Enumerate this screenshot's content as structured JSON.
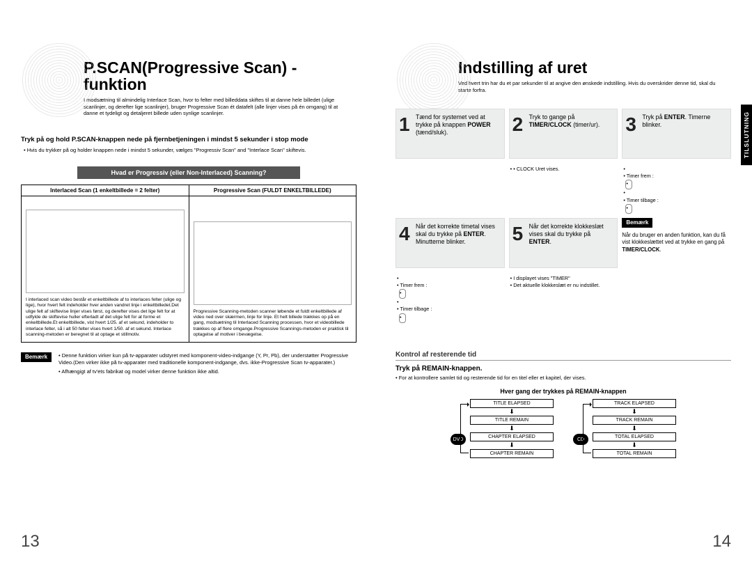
{
  "left": {
    "title": "P.SCAN(Progressive Scan) -funktion",
    "intro": "I modsætning til almindelig Interlace Scan, hvor to felter med billeddata skiftes til at danne hele billedet (ulige scanlinjer, og derefter lige scanlinjer), bruger Progressive Scan ét datafelt (alle linjer vises på én omgang) til at danne et tydeligt og detaljeret billede uden synlige scanlinjer.",
    "instr_title": "Tryk på og hold P.SCAN-knappen nede på fjernbetjeningen i mindst 5 sekunder i stop mode",
    "instr_bullet": "Hvis du trykker på og holder knappen nede i mindst 5 sekunder, vælges \"Progressiv Scan\" and \"Interlace Scan\" skiftevis.",
    "q_heading": "Hvad er Progressiv (eller Non-Interlaced) Scanning?",
    "col_a": "Interlaced Scan (1 enkeltbillede = 2 felter)",
    "col_b": "Progressive Scan (FULDT ENKELTBILLEDE)",
    "desc_a": "I interlaced scan video består et enkeltbillede af to interlaces felter (ulige og lige), hvor hvert felt indeholder hver anden vandret linje i enkeltbilledet.Det ulige felt af skiftevise linjer vises først, og derefter vises det lige felt for at udfylde de skiftevise huller efterladt af det ulige felt for at forme et enkeltbillede.Et enkeltbillede, vist hvert 1/25. af et sekund, indeholder to interlace felter, så i alt 50 felter vises hvert 1/50. af et sekund. Interlace scanning-metoden er beregnet til at optage et stillmotiv.",
    "desc_b": "Progressive Scanning-metoden scanner løbende et fuldt enkeltbillede af video ned over skærmen, linje for linje. Et helt billede trækkes op på en gang, modsætning til Interlaced Scanning processen, hvor et videobillede trækkes op af flere omgange.Progressive Scannings-metoden er praktisk til optagelse af motiver i bevægelse.",
    "note_label": "Bemærk",
    "note1": "Denne funktion virker kun på tv-apparater udstyret med komponent-video-indgange (Y, Pr, Pb), der understøtter Progressive Video.(Den virker ikke på tv-apparater med traditionelle komponent-indgange, dvs. ikke-Progressive Scan tv-apparater.)",
    "note2": "Afhængigt af tv'ets fabrikat og model virker denne funktion ikke altid.",
    "pagenum": "13"
  },
  "right": {
    "title": "Indstilling af uret",
    "intro": "Ved hvert trin har du et par sekunder til at angive den ønskede indstilling. Hvis du overskrider denne tid, skal du starte forfra.",
    "side_tab": "TILSLUTNING",
    "steps": [
      {
        "num": "1",
        "html": "Tænd for systemet ved at trykke på knappen <strong>POWER</strong> (tænd/sluk)."
      },
      {
        "num": "2",
        "html": "Tryk to gange på <strong>TIMER/CLOCK</strong> (timer/ur)."
      },
      {
        "num": "3",
        "html": "Tryk på <strong>ENTER</strong>. Timerne blinker."
      },
      {
        "num": "4",
        "html": "Når det korrekte timetal vises skal du trykke på <strong>ENTER</strong>. Minutterne blinker."
      },
      {
        "num": "5",
        "html": "Når det korrekte klokkeslæt vises skal du trykke på <strong>ENTER</strong>."
      }
    ],
    "micro": {
      "s2": "• CLOCK Uret vises.",
      "s3a": "Timer frem    :",
      "s3b": "Timer tilbage :",
      "s4a": "Timer frem    :",
      "s4b": "Timer tilbage :",
      "s5a": "I displayet vises \"TIMER\"",
      "s5b": "Det aktuelle klokkeslæt er nu indstillet."
    },
    "note_label": "Bemærk",
    "note_body": "Når du bruger en anden funktion, kan du få vist klokkeslættet ved at trykke en gang på <strong>TIMER/CLOCK</strong>.",
    "remain": {
      "heading": "Kontrol af resterende tid",
      "action": "Tryk på REMAIN-knappen.",
      "bullet": "For at kontrollere samlet tid og resterende tid for en titel eller et kapitel, der vises.",
      "every": "Hver gang der trykkes på REMAIN-knappen",
      "dvd_label": "DVD",
      "cd_label": "CD",
      "dvd": [
        "TITLE ELAPSED",
        "TITLE REMAIN",
        "CHAPTER ELAPSED",
        "CHAPTER REMAIN"
      ],
      "cd": [
        "TRACK ELAPSED",
        "TRACK REMAIN",
        "TOTAL ELAPSED",
        "TOTAL REMAIN"
      ]
    },
    "pagenum": "14"
  }
}
